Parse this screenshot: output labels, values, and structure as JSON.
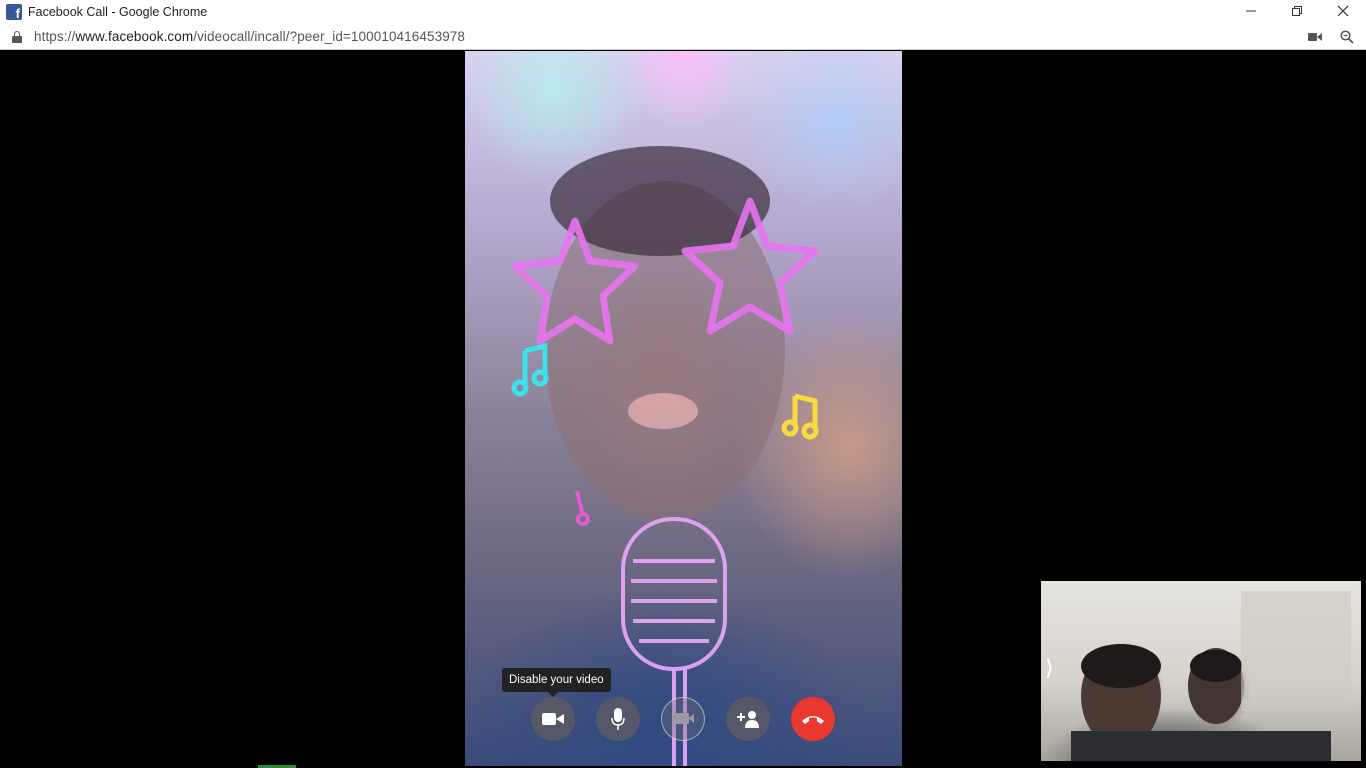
{
  "window": {
    "title": "Facebook Call - Google Chrome",
    "favicon": "facebook-icon",
    "controls": [
      "minimize-icon",
      "restore-icon",
      "close-icon"
    ]
  },
  "addressbar": {
    "url_scheme": "https://",
    "url_host": "www.facebook.com",
    "url_path": "/videocall/incall/?peer_id=100010416453978",
    "right_icons": [
      "camera-icon",
      "zoom-icon"
    ]
  },
  "call": {
    "tooltip": "Disable your video",
    "controls": [
      {
        "name": "disable-video-button",
        "icon": "video-camera-icon"
      },
      {
        "name": "mute-button",
        "icon": "microphone-icon"
      },
      {
        "name": "screen-share-button",
        "icon": "screen-share-icon",
        "disabled": true
      },
      {
        "name": "add-person-button",
        "icon": "add-person-icon"
      },
      {
        "name": "end-call-button",
        "icon": "phone-hangup-icon",
        "color": "#e8382f"
      }
    ],
    "pip_toggle": "⟩"
  },
  "colors": {
    "end_call": "#e8382f",
    "facebook_blue": "#3b5998"
  }
}
